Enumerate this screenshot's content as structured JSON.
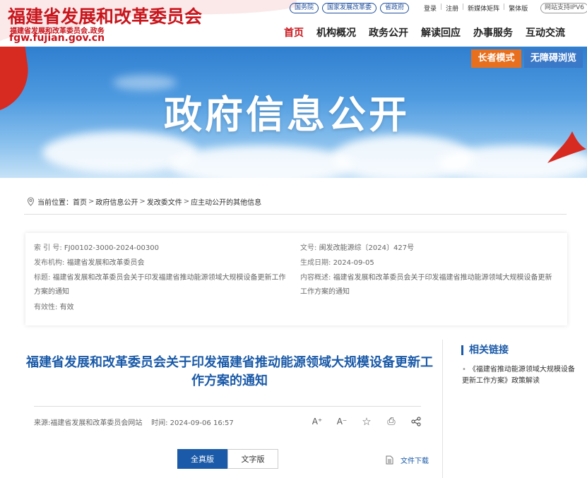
{
  "header": {
    "logo_main": "福建省发展和改革委员会",
    "logo_sub": "福建省发展和改革委员会.政务",
    "logo_url": "fgw.fujian.gov.cn",
    "top_links": [
      "国务院",
      "国家发展改革委",
      "省政府"
    ],
    "user_links": [
      "登录",
      "注册",
      "新媒体矩阵",
      "繁体版"
    ],
    "ipv6": "网站支持IPV6",
    "nav": [
      "首页",
      "机构概况",
      "政务公开",
      "解读回应",
      "办事服务",
      "互动交流"
    ]
  },
  "banner": {
    "title": "政府信息公开",
    "elder_mode": "长者模式",
    "accessible": "无障碍浏览"
  },
  "breadcrumb": {
    "label": "当前位置：",
    "items": [
      "首页",
      "政府信息公开",
      "发改委文件",
      "应主动公开的其他信息"
    ],
    "sep": ">"
  },
  "meta": {
    "index_label": "索 引 号:",
    "index_value": "FJ00102-3000-2024-00300",
    "docno_label": "文号:",
    "docno_value": "闽发改能源综〔2024〕427号",
    "publisher_label": "发布机构:",
    "publisher_value": "福建省发展和改革委员会",
    "date_label": "生成日期:",
    "date_value": "2024-09-05",
    "title_label": "标题:",
    "title_value": "福建省发展和改革委员会关于印发福建省推动能源领域大规模设备更新工作方案的通知",
    "summary_label": "内容概述:",
    "summary_value": "福建省发展和改革委员会关于印发福建省推动能源领域大规模设备更新工作方案的通知",
    "validity_label": "有效性:",
    "validity_value": "有效"
  },
  "article": {
    "title": "福建省发展和改革委员会关于印发福建省推动能源领域大规模设备更新工作方案的通知",
    "source_label": "来源:",
    "source_value": "福建省发展和改革委员会网站",
    "time_label": "时间:",
    "time_value": "2024-09-06 16:57",
    "tools": {
      "font_up": "A⁺",
      "font_down": "A⁻",
      "favorite": "☆",
      "print": "⎙",
      "share": "share-icon"
    },
    "version_full": "全真版",
    "version_text": "文字版",
    "download": "文件下载"
  },
  "sidebar": {
    "title": "相关链接",
    "links": [
      "《福建省推动能源领域大规模设备更新工作方案》政策解读"
    ]
  }
}
